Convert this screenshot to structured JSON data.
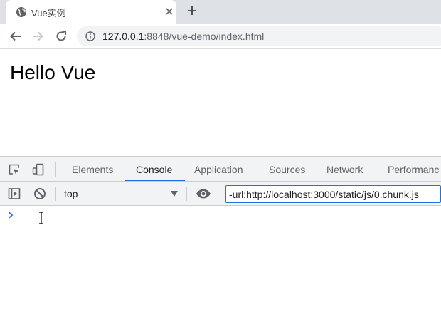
{
  "browser": {
    "tab": {
      "title": "Vue实例",
      "favicon": "globe-icon",
      "close": "close-icon"
    },
    "new_tab": "plus-icon",
    "nav": {
      "back": "arrow-left-icon",
      "forward": "arrow-right-icon",
      "reload": "reload-icon"
    },
    "address": {
      "security": "info-icon",
      "host": "127.0.0.1",
      "rest": ":8848/vue-demo/index.html"
    }
  },
  "page": {
    "heading": "Hello Vue"
  },
  "devtools": {
    "tabs": [
      {
        "label": "Elements",
        "active": false
      },
      {
        "label": "Console",
        "active": true
      },
      {
        "label": "Application",
        "active": false
      },
      {
        "label": "Sources",
        "active": false
      },
      {
        "label": "Network",
        "active": false
      },
      {
        "label": "Performanc",
        "active": false
      }
    ],
    "accent_color": "#1a73e8",
    "console": {
      "context": "top",
      "filter_value": "-url:http://localhost:3000/static/js/0.chunk.js",
      "prompt_icon": "chevron-right-icon"
    }
  }
}
